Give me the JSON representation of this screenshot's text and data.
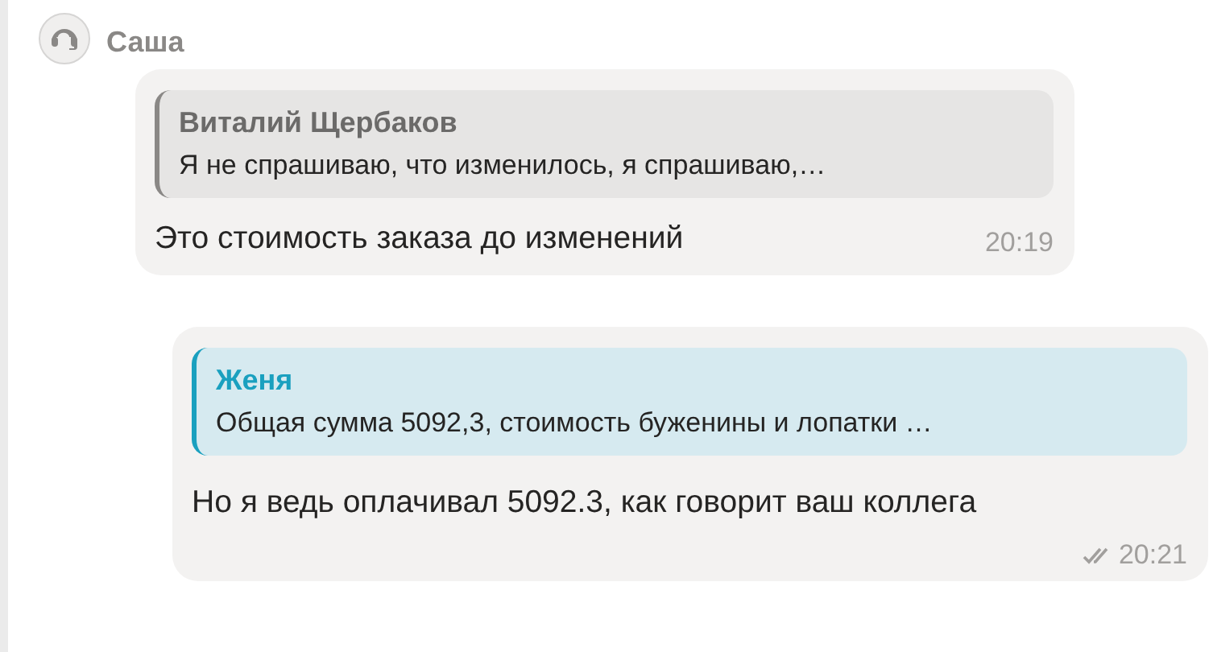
{
  "sender": {
    "name": "Саша"
  },
  "messages": [
    {
      "kind": "incoming",
      "quote": {
        "author": "Виталий Щербаков",
        "text": "Я не спрашиваю, что изменилось, я спрашиваю,…",
        "kind": "other"
      },
      "text": "Это стоимость заказа до изменений",
      "time": "20:19",
      "read": false
    },
    {
      "kind": "outgoing",
      "quote": {
        "author": "Женя",
        "text": "Общая сумма 5092,3, стоимость буженины и лопатки …",
        "kind": "highlight"
      },
      "text": "Но я ведь оплачивал 5092.3, как говорит ваш коллега",
      "time": "20:21",
      "read": true
    }
  ]
}
